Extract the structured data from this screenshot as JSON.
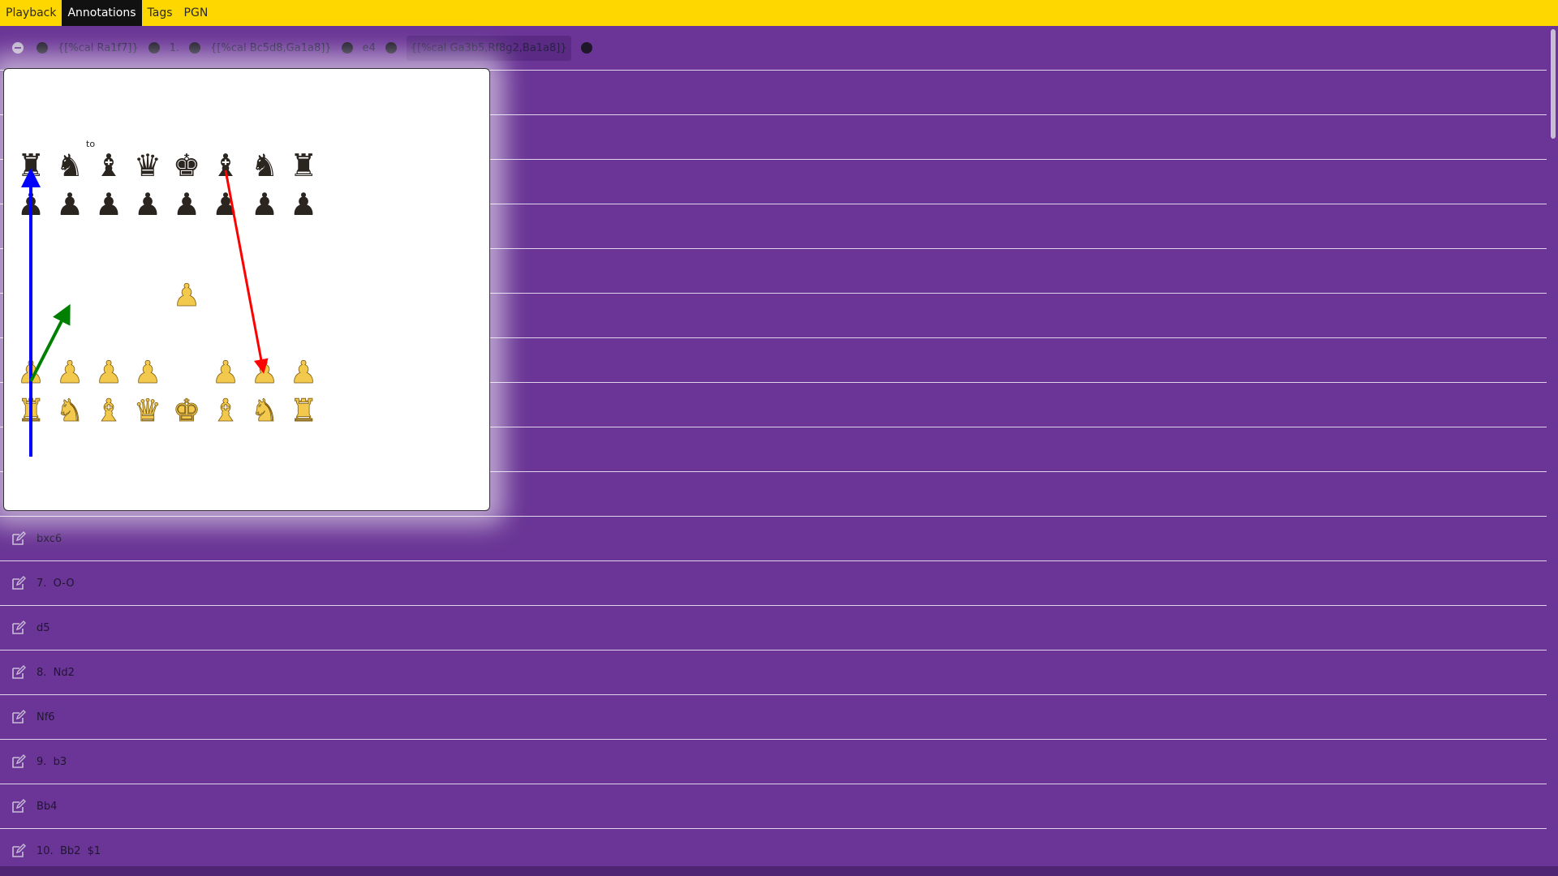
{
  "tabs": [
    {
      "label": "Playback",
      "active": false
    },
    {
      "label": "Annotations",
      "active": true
    },
    {
      "label": "Tags",
      "active": false
    },
    {
      "label": "PGN",
      "active": false
    }
  ],
  "top_row": {
    "items": [
      {
        "type": "comment",
        "text": "{[%cal Ra1f7]}"
      },
      {
        "type": "move",
        "text": "1."
      },
      {
        "type": "comment",
        "text": "{[%cal Bc5d8,Ga1a8]}"
      },
      {
        "type": "move",
        "text": "e4"
      },
      {
        "type": "comment",
        "text": "{[%cal Ga3b5,Rf8g2,Ba1a8]}",
        "highlighted": true
      }
    ]
  },
  "popup": {
    "label": "to",
    "arrows": [
      {
        "color": "#0000ff",
        "from": "a1",
        "to": "a8"
      },
      {
        "color": "#008000",
        "from": "a3",
        "to": "b5"
      },
      {
        "color": "#ff0000",
        "from": "f8",
        "to": "g2"
      }
    ]
  },
  "move_rows": [
    "bxc6",
    "7.  O-O",
    "d5",
    "8.  Nd2",
    "Nf6",
    "9.  b3",
    "Bb4",
    "10.  Bb2  $1"
  ],
  "colors": {
    "topbar": "#ffd700",
    "background": "#6a3596",
    "active_tab": "#111111"
  }
}
